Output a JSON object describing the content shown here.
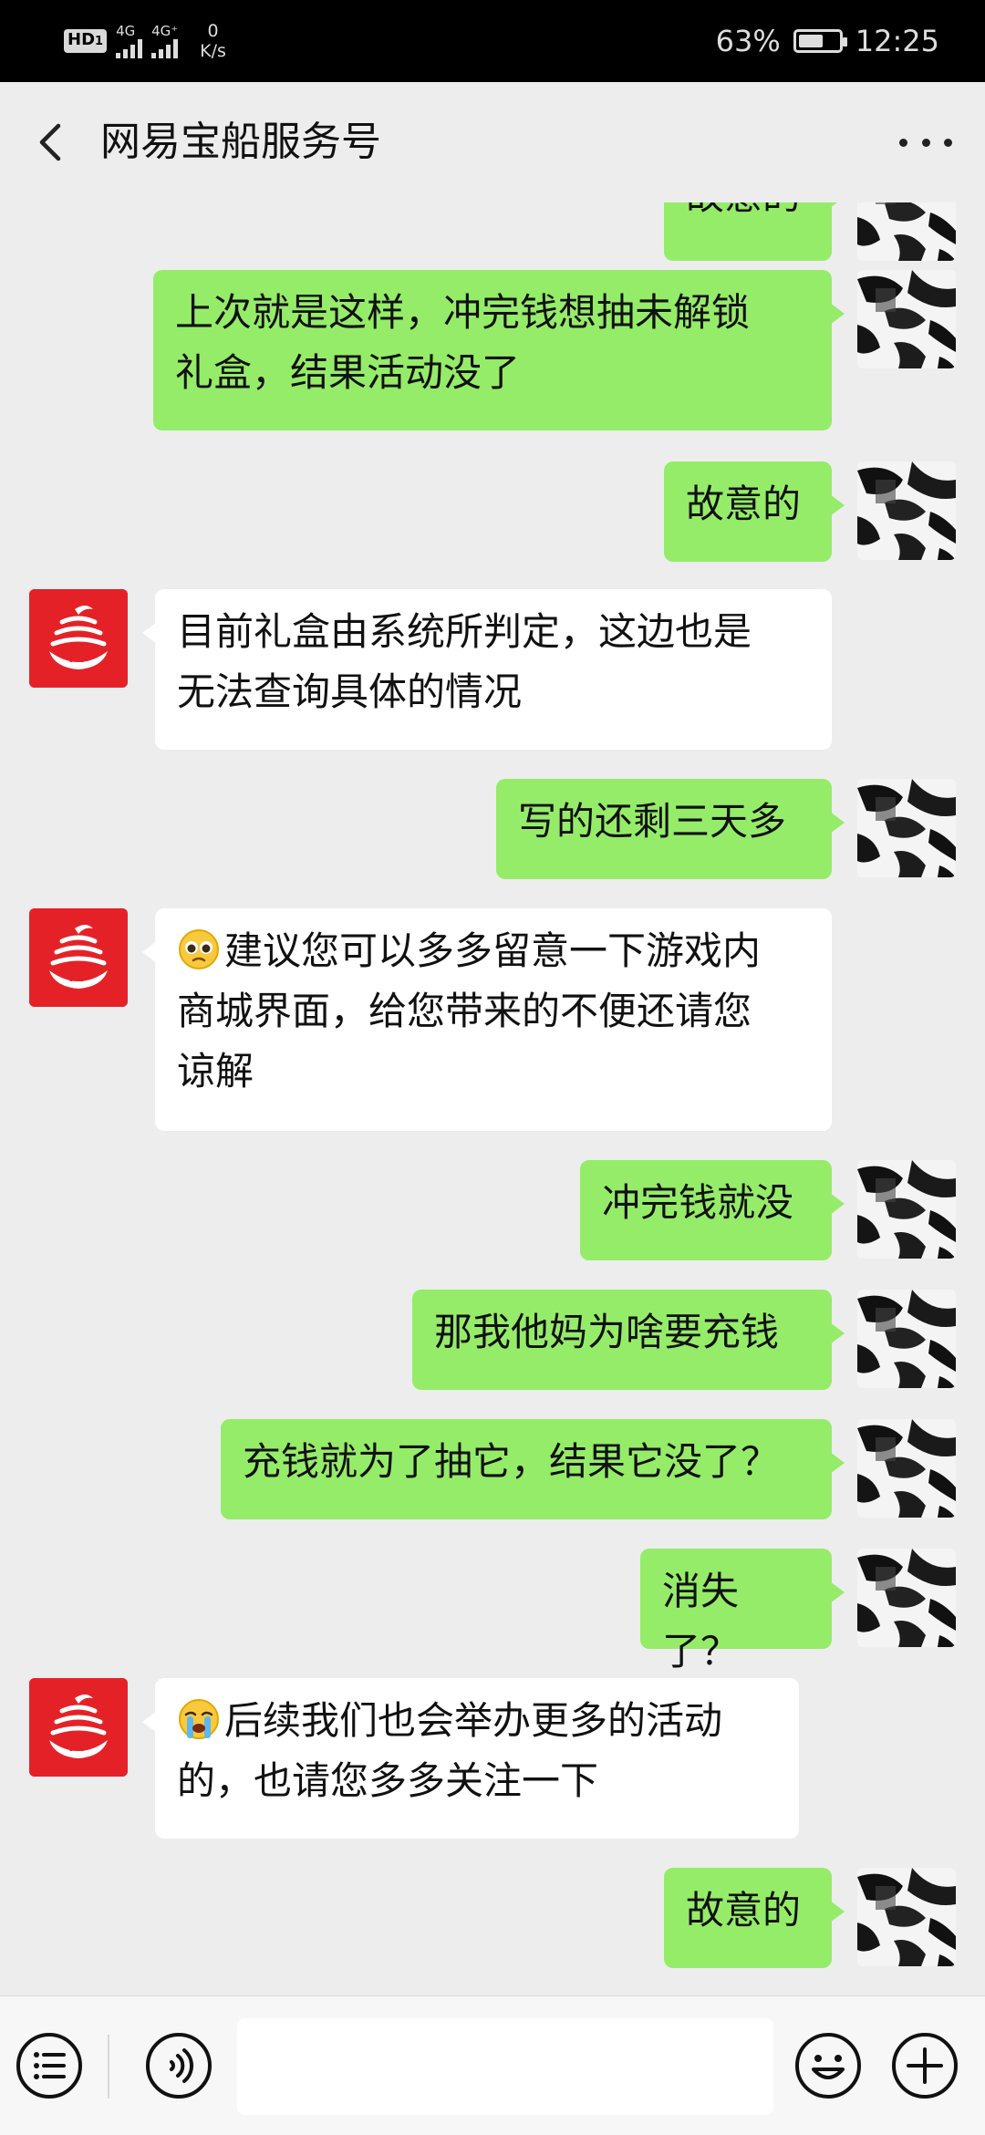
{
  "status_bar": {
    "hd": "HD",
    "hd_sub": "1",
    "net1": "4G",
    "net2": "4G⁺",
    "speed_value": "0",
    "speed_unit": "K/s",
    "battery": "63%",
    "battery_level": 0.63,
    "time": "12:25"
  },
  "header": {
    "title": "网易宝船服务号"
  },
  "colors": {
    "sent_bubble": "#95ec69",
    "recv_bubble": "#ffffff",
    "background": "#ededed",
    "brand_red": "#e52128"
  },
  "messages": [
    {
      "side": "sent",
      "lines": [
        "故意的"
      ],
      "avatar": "user-avatar"
    },
    {
      "side": "sent",
      "lines": [
        "上次就是这样，冲完钱想抽未解锁",
        "礼盒，结果活动没了"
      ],
      "avatar": "user-avatar"
    },
    {
      "side": "sent",
      "lines": [
        "故意的"
      ],
      "avatar": "user-avatar"
    },
    {
      "side": "recv",
      "lines": [
        "目前礼盒由系统所判定，这边也是",
        "无法查询具体的情况"
      ],
      "avatar": "netease-ship-logo"
    },
    {
      "side": "sent",
      "lines": [
        "写的还剩三天多"
      ],
      "avatar": "user-avatar"
    },
    {
      "side": "recv",
      "emoji": "pleading-face-emoji",
      "lines": [
        "建议您可以多多留意一下游戏内",
        "商城界面，给您带来的不便还请您",
        "谅解"
      ],
      "avatar": "netease-ship-logo"
    },
    {
      "side": "sent",
      "lines": [
        "冲完钱就没"
      ],
      "avatar": "user-avatar"
    },
    {
      "side": "sent",
      "lines": [
        "那我他妈为啥要充钱"
      ],
      "avatar": "user-avatar"
    },
    {
      "side": "sent",
      "lines": [
        "充钱就为了抽它，结果它没了？"
      ],
      "avatar": "user-avatar"
    },
    {
      "side": "sent",
      "lines": [
        "消失了？"
      ],
      "avatar": "user-avatar"
    },
    {
      "side": "recv",
      "emoji": "crying-face-emoji",
      "lines": [
        "后续我们也会举办更多的活动",
        "的，也请您多多关注一下"
      ],
      "avatar": "netease-ship-logo"
    },
    {
      "side": "sent",
      "lines": [
        "故意的"
      ],
      "avatar": "user-avatar"
    }
  ],
  "input_bar": {
    "menu_icon": "menu-list-icon",
    "voice_icon": "voice-icon",
    "text_value": "",
    "emoji_icon": "emoji-icon",
    "plus_icon": "plus-icon"
  }
}
